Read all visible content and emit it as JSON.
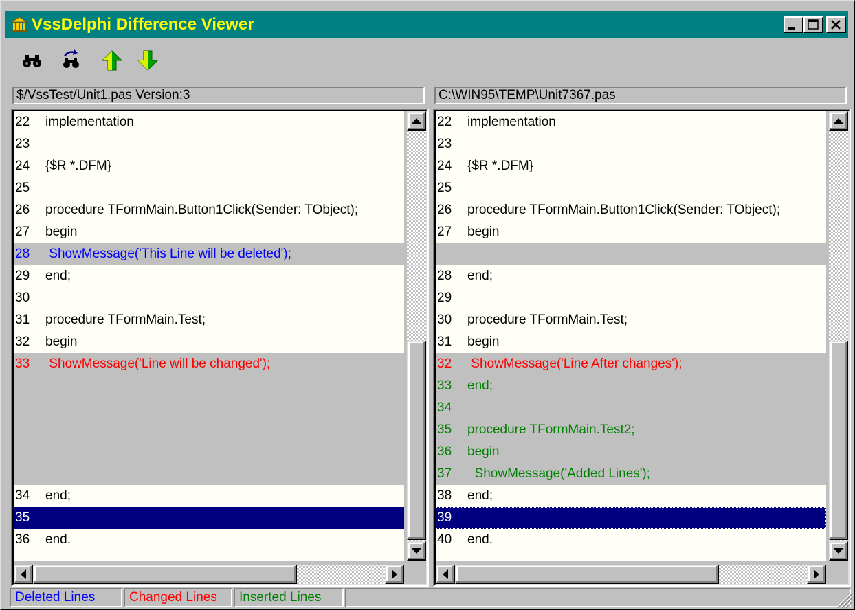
{
  "window": {
    "title": "VssDelphi Difference Viewer",
    "title_color": "#ffff00",
    "titlebar_color": "#008080",
    "caption_buttons": [
      "minimize-icon",
      "maximize-icon",
      "close-icon"
    ]
  },
  "toolbar": {
    "buttons": [
      {
        "name": "find-button",
        "icon": "binoculars-icon"
      },
      {
        "name": "find-next-button",
        "icon": "find-next-icon"
      },
      {
        "name": "previous-difference-button",
        "icon": "arrow-up-icon"
      },
      {
        "name": "next-difference-button",
        "icon": "arrow-down-icon"
      }
    ]
  },
  "colors": {
    "deleted": "#0000ff",
    "changed": "#ff0000",
    "inserted": "#008000",
    "diff_background": "#c0c0c0",
    "selection": "#000080"
  },
  "left_pane": {
    "header": "$/VssTest/Unit1.pas Version:3",
    "lines": [
      {
        "num": "22",
        "text": "implementation",
        "state": "normal"
      },
      {
        "num": "23",
        "text": "",
        "state": "normal"
      },
      {
        "num": "24",
        "text": "{$R *.DFM}",
        "state": "normal"
      },
      {
        "num": "25",
        "text": "",
        "state": "normal"
      },
      {
        "num": "26",
        "text": "procedure TFormMain.Button1Click(Sender: TObject);",
        "state": "normal"
      },
      {
        "num": "27",
        "text": "begin",
        "state": "normal"
      },
      {
        "num": "28",
        "text": " ShowMessage('This Line will be deleted');",
        "state": "deleted"
      },
      {
        "num": "29",
        "text": "end;",
        "state": "normal"
      },
      {
        "num": "30",
        "text": "",
        "state": "normal"
      },
      {
        "num": "31",
        "text": "procedure TFormMain.Test;",
        "state": "normal"
      },
      {
        "num": "32",
        "text": "begin",
        "state": "normal"
      },
      {
        "num": "33",
        "text": " ShowMessage('Line will be changed');",
        "state": "changed"
      },
      {
        "num": "",
        "text": "",
        "state": "spacer"
      },
      {
        "num": "",
        "text": "",
        "state": "spacer"
      },
      {
        "num": "",
        "text": "",
        "state": "spacer"
      },
      {
        "num": "",
        "text": "",
        "state": "spacer"
      },
      {
        "num": "",
        "text": "",
        "state": "spacer"
      },
      {
        "num": "34",
        "text": "end;",
        "state": "normal"
      },
      {
        "num": "35",
        "text": "",
        "state": "selected"
      },
      {
        "num": "36",
        "text": "end.",
        "state": "normal"
      }
    ]
  },
  "right_pane": {
    "header": "C:\\WIN95\\TEMP\\Unit7367.pas",
    "lines": [
      {
        "num": "22",
        "text": "implementation",
        "state": "normal"
      },
      {
        "num": "23",
        "text": "",
        "state": "normal"
      },
      {
        "num": "24",
        "text": "{$R *.DFM}",
        "state": "normal"
      },
      {
        "num": "25",
        "text": "",
        "state": "normal"
      },
      {
        "num": "26",
        "text": "procedure TFormMain.Button1Click(Sender: TObject);",
        "state": "normal"
      },
      {
        "num": "27",
        "text": "begin",
        "state": "normal"
      },
      {
        "num": "",
        "text": "",
        "state": "spacer"
      },
      {
        "num": "28",
        "text": "end;",
        "state": "normal"
      },
      {
        "num": "29",
        "text": "",
        "state": "normal"
      },
      {
        "num": "30",
        "text": "procedure TFormMain.Test;",
        "state": "normal"
      },
      {
        "num": "31",
        "text": "begin",
        "state": "normal"
      },
      {
        "num": "32",
        "text": " ShowMessage('Line After changes');",
        "state": "changed"
      },
      {
        "num": "33",
        "text": "end;",
        "state": "inserted"
      },
      {
        "num": "34",
        "text": "",
        "state": "inserted"
      },
      {
        "num": "35",
        "text": "procedure TFormMain.Test2;",
        "state": "inserted"
      },
      {
        "num": "36",
        "text": "begin",
        "state": "inserted"
      },
      {
        "num": "37",
        "text": "  ShowMessage('Added Lines');",
        "state": "inserted"
      },
      {
        "num": "38",
        "text": "end;",
        "state": "normal"
      },
      {
        "num": "39",
        "text": "",
        "state": "selected"
      },
      {
        "num": "40",
        "text": "end.",
        "state": "normal"
      }
    ]
  },
  "statusbar": {
    "deleted_label": "Deleted Lines",
    "changed_label": "Changed Lines",
    "inserted_label": "Inserted Lines"
  }
}
